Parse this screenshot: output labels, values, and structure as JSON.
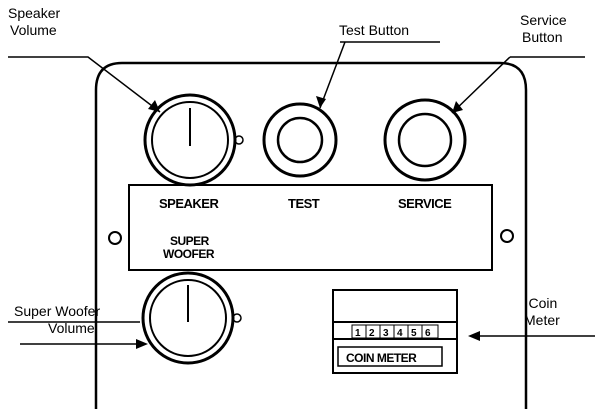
{
  "callouts": {
    "speaker_volume": [
      "Speaker",
      "Volume"
    ],
    "test_button": "Test Button",
    "service_button": [
      "Service",
      "Button"
    ],
    "super_woofer_volume": [
      "Super Woofer",
      "Volume"
    ],
    "coin_meter": [
      "Coin",
      "Meter"
    ]
  },
  "panel": {
    "speaker": "SPEAKER",
    "test": "TEST",
    "service": "SERVICE",
    "super_woofer": [
      "SUPER",
      "WOOFER"
    ],
    "coin_meter": "COIN METER",
    "counter_digits": [
      "1",
      "2",
      "3",
      "4",
      "5",
      "6"
    ]
  }
}
